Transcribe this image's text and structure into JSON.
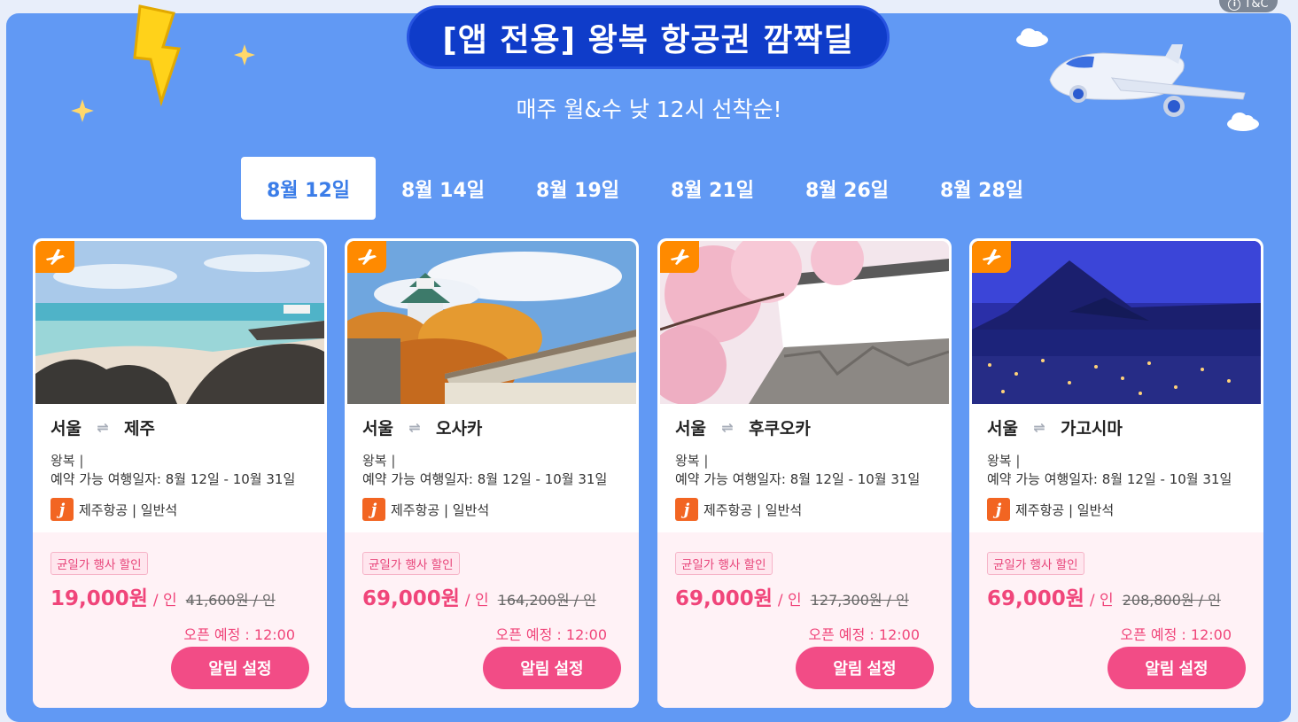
{
  "header": {
    "title": "[앱 전용] 왕복 항공권 깜짝딜",
    "subtitle": "매주 월&수 낮 12시 선착순!",
    "tc_label": "T&C"
  },
  "tabs": [
    {
      "label": "8월 12일",
      "active": true
    },
    {
      "label": "8월 14일",
      "active": false
    },
    {
      "label": "8월 19일",
      "active": false
    },
    {
      "label": "8월 21일",
      "active": false
    },
    {
      "label": "8월 26일",
      "active": false
    },
    {
      "label": "8월 28일",
      "active": false
    }
  ],
  "cards": [
    {
      "from": "서울",
      "to": "제주",
      "trip": "왕복 |",
      "dates": "예약 가능 여행일자: 8월 12일 - 10월 31일",
      "airline": "제주항공 | 일반석",
      "tag": "균일가 행사 할인",
      "price": "19,000원",
      "per": "/ 인",
      "old_price": "41,600원 / 인",
      "open": "오픈 예정 : 12:00",
      "button": "알림 설정",
      "photo": "beach"
    },
    {
      "from": "서울",
      "to": "오사카",
      "trip": "왕복 |",
      "dates": "예약 가능 여행일자: 8월 12일 - 10월 31일",
      "airline": "제주항공 | 일반석",
      "tag": "균일가 행사 할인",
      "price": "69,000원",
      "per": "/ 인",
      "old_price": "164,200원 / 인",
      "open": "오픈 예정 : 12:00",
      "button": "알림 설정",
      "photo": "castle"
    },
    {
      "from": "서울",
      "to": "후쿠오카",
      "trip": "왕복 |",
      "dates": "예약 가능 여행일자: 8월 12일 - 10월 31일",
      "airline": "제주항공 | 일반석",
      "tag": "균일가 행사 할인",
      "price": "69,000원",
      "per": "/ 인",
      "old_price": "127,300원 / 인",
      "open": "오픈 예정 : 12:00",
      "button": "알림 설정",
      "photo": "blossom"
    },
    {
      "from": "서울",
      "to": "가고시마",
      "trip": "왕복 |",
      "dates": "예약 가능 여행일자: 8월 12일 - 10월 31일",
      "airline": "제주항공 | 일반석",
      "tag": "균일가 행사 할인",
      "price": "69,000원",
      "per": "/ 인",
      "old_price": "208,800원 / 인",
      "open": "오픈 예정 : 12:00",
      "button": "알림 설정",
      "photo": "night"
    }
  ],
  "colors": {
    "panel": "#6199f4",
    "accent_pink": "#f24c86",
    "title_blue": "#0f3cc9",
    "badge_orange": "#ff8a00"
  }
}
